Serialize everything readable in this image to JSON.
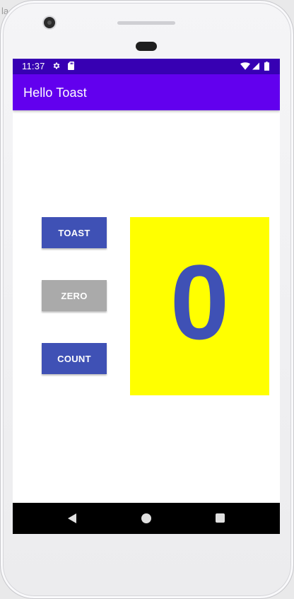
{
  "background": {
    "label": "la"
  },
  "status_bar": {
    "time": "11:37",
    "icons": [
      "settings-gear-icon",
      "sd-card-icon",
      "wifi-icon",
      "cell-signal-icon",
      "battery-icon"
    ],
    "color": "#3700b3"
  },
  "app_bar": {
    "title": "Hello Toast",
    "color": "#6200ee"
  },
  "buttons": {
    "toast_label": "TOAST",
    "zero_label": "ZERO",
    "count_label": "COUNT"
  },
  "counter": {
    "value": "0",
    "panel_color": "#ffff00",
    "text_color": "#3f51b5"
  },
  "colors": {
    "primary": "#3f51b5",
    "zero_button": "#aaaaaa",
    "nav_bar": "#000000"
  },
  "nav_bar": {
    "icons": [
      "back-icon",
      "home-icon",
      "recents-icon"
    ]
  }
}
